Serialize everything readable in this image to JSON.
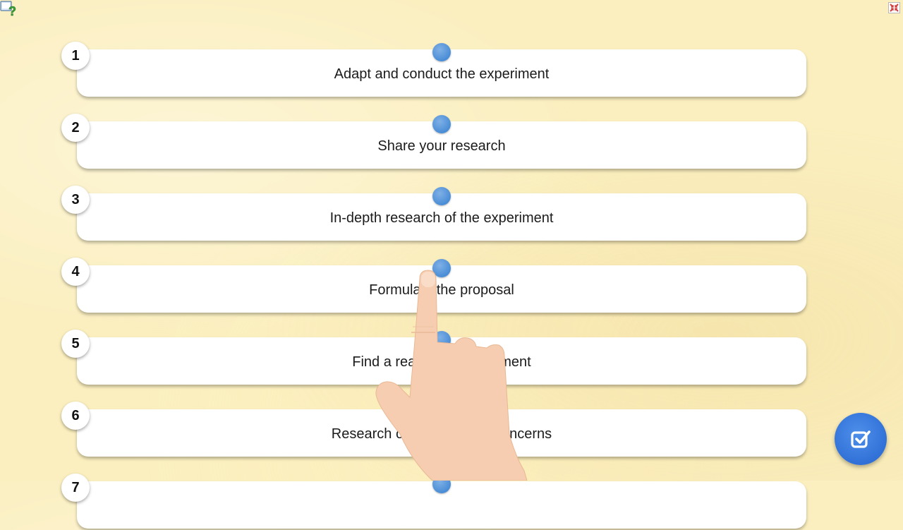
{
  "icons": {
    "help": "help-question-icon",
    "fullscreen": "fullscreen-exit-icon",
    "check": "checkbox-checked-icon",
    "hand": "pointing-hand-cursor",
    "drag_handle": "drag-handle-dot"
  },
  "colors": {
    "handle": "#4a8dd6",
    "check_button": "#2f6fd6",
    "background": "#fbefbf"
  },
  "items": [
    {
      "number": "1",
      "label": "Adapt and conduct the experiment"
    },
    {
      "number": "2",
      "label": "Share your research"
    },
    {
      "number": "3",
      "label": "In-depth research of the experiment"
    },
    {
      "number": "4",
      "label": "Formulate the proposal"
    },
    {
      "number": "5",
      "label": "Find a reachable experiment"
    },
    {
      "number": "6",
      "label": "Research cost and safety concerns"
    },
    {
      "number": "7",
      "label": ""
    }
  ]
}
